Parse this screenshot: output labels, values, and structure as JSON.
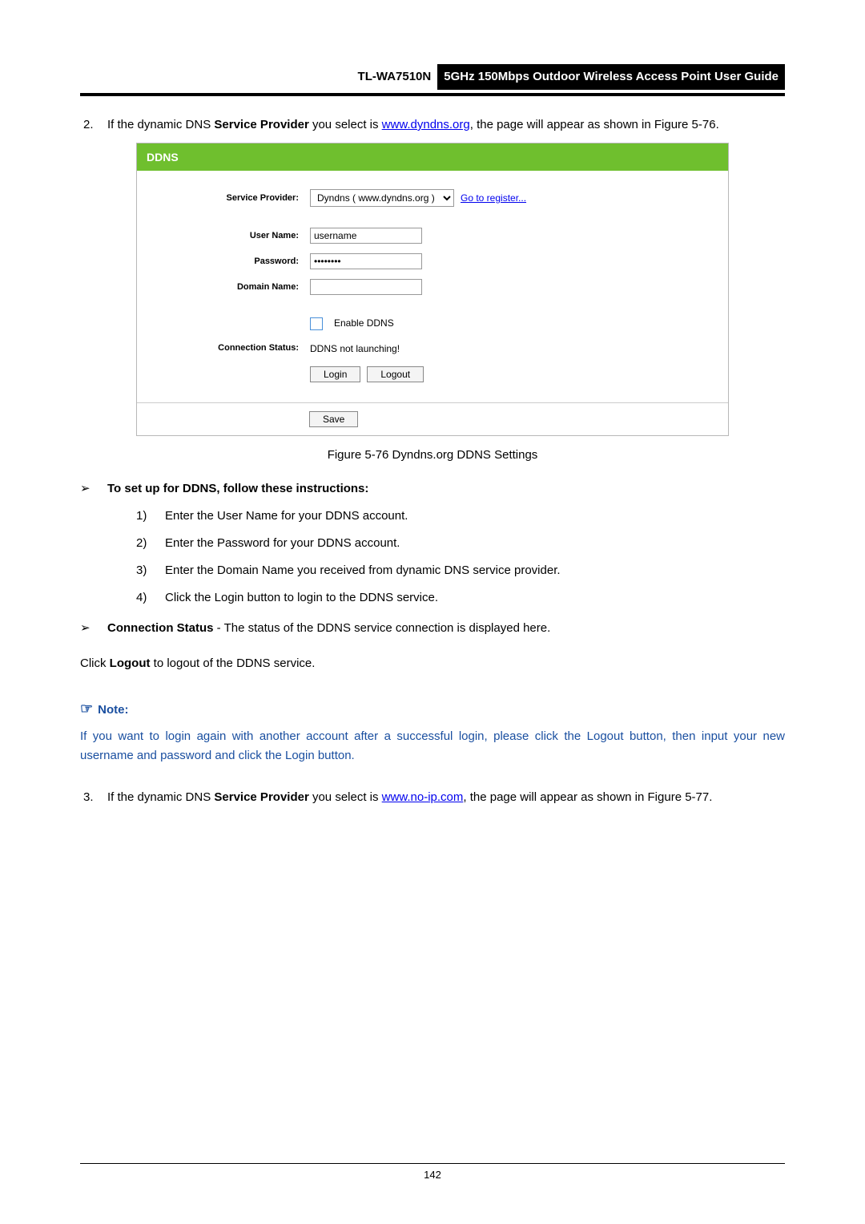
{
  "header": {
    "model": "TL-WA7510N",
    "title": "5GHz 150Mbps Outdoor Wireless Access Point User Guide"
  },
  "item2": {
    "num": "2.",
    "before": "If the dynamic DNS ",
    "bold1": "Service Provider",
    "mid": " you select is ",
    "link": "www.dyndns.org",
    "after": ", the page will appear as shown in Figure 5-76."
  },
  "ddns": {
    "title": "DDNS",
    "labels": {
      "serviceProvider": "Service Provider:",
      "userName": "User Name:",
      "password": "Password:",
      "domainName": "Domain Name:",
      "connectionStatus": "Connection Status:"
    },
    "serviceSelect": "Dyndns ( www.dyndns.org )",
    "registerLink": "Go to register...",
    "userNameValue": "username",
    "passwordValue": "••••••••",
    "domainNameValue": "",
    "enableLabel": "Enable DDNS",
    "connStatusText": "DDNS not launching!",
    "btnLogin": "Login",
    "btnLogout": "Logout",
    "btnSave": "Save"
  },
  "figCaption": "Figure 5-76 Dyndns.org DDNS Settings",
  "instrHead": {
    "arw": "➢",
    "text": "To set up for DDNS, follow these instructions:"
  },
  "steps": [
    {
      "n": "1)",
      "t": "Enter the User Name for your DDNS account."
    },
    {
      "n": "2)",
      "t": "Enter the Password for your DDNS account."
    },
    {
      "n": "3)",
      "t": "Enter the Domain Name you received from dynamic DNS service provider."
    },
    {
      "n": "4)",
      "t": "Click the Login button to login to the DDNS service."
    }
  ],
  "connStatusLine": {
    "arw": "➢",
    "bold": "Connection Status",
    "rest": " - The status of the DDNS service connection is displayed here."
  },
  "logoutLine": {
    "pre": "Click ",
    "bold": "Logout",
    "post": " to logout of the DDNS service."
  },
  "note": {
    "hand": "☞",
    "label": "Note:",
    "body": "If you want to login again with another account after a successful login, please click the Logout button, then input your new username and password and click the Login button."
  },
  "item3": {
    "num": "3.",
    "before": "If the dynamic DNS ",
    "bold1": "Service Provider",
    "mid": " you select is ",
    "link": "www.no-ip.com",
    "after": ", the page will appear as shown in Figure 5-77."
  },
  "pageNumber": "142"
}
